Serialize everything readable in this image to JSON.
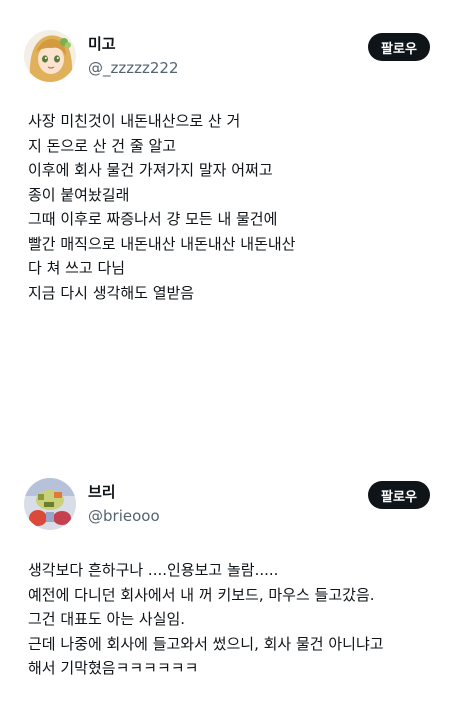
{
  "posts": [
    {
      "name": "미고",
      "handle": "@_zzzzz222",
      "follow_label": "팔로우",
      "avatar_icon": "anime-girl-avatar",
      "lines": [
        "사장 미친것이 내돈내산으로 산 거",
        "지 돈으로 산 건 줄 알고",
        "이후에 회사 물건 가져가지 말자 어쩌고",
        "종이 붙여놨길래",
        "그때 이후로 짜증나서 걍 모든 내 물건에",
        "빨간 매직으로 내돈내산 내돈내산 내돈내산",
        "다 쳐 쓰고 다님",
        "지금 다시 생각해도 열받음"
      ]
    },
    {
      "name": "브리",
      "handle": "@brieooo",
      "follow_label": "팔로우",
      "avatar_icon": "pixel-character-avatar",
      "lines": [
        "생각보다 흔하구나 ....인용보고 놀람.....",
        "예전에 다니던 회사에서 내 꺼 키보드, 마우스 들고갔음.",
        "그건 대표도 아는 사실임.",
        "근데 나중에 회사에 들고와서 썼으니, 회사 물건 아니냐고",
        "해서 기막혔음ㅋㅋㅋㅋㅋㅋ"
      ]
    }
  ]
}
